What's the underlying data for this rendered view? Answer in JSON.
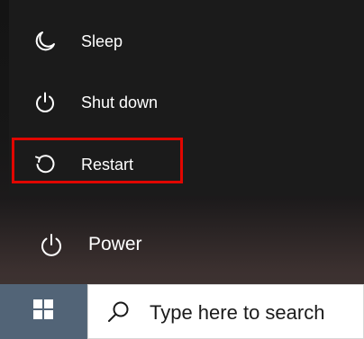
{
  "power_menu": {
    "items": [
      {
        "label": "Sleep",
        "icon": "moon-icon"
      },
      {
        "label": "Shut down",
        "icon": "power-icon"
      },
      {
        "label": "Restart",
        "icon": "restart-icon"
      }
    ],
    "highlighted_item": "Restart",
    "highlight_color": "#e10600"
  },
  "start_menu": {
    "power_label": "Power",
    "power_icon": "power-icon"
  },
  "taskbar": {
    "start_icon": "windows-logo-icon",
    "search": {
      "placeholder": "Type here to search",
      "icon": "search-icon"
    }
  },
  "colors": {
    "menu_background": "#1b1b1b",
    "taskbar_background": "#5b6c7c",
    "text": "#ffffff"
  }
}
